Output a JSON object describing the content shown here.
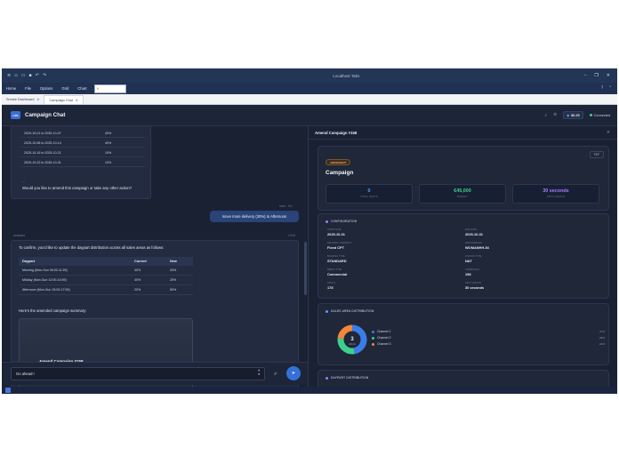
{
  "window": {
    "title": "Localhost Tabs",
    "controls": {
      "minimize": "–",
      "restore": "❐",
      "close": "✕"
    }
  },
  "ribbon": {
    "items": [
      "Home",
      "File",
      "Options",
      "Grid",
      "Chart"
    ],
    "search_value": "V"
  },
  "doc_tabs": [
    {
      "label": "Smoke Dashboard",
      "active": false
    },
    {
      "label": "Campaign Chat",
      "active": true
    }
  ],
  "header": {
    "logo_text": "LMS",
    "title": "Campaign Chat",
    "cost": "$0.25",
    "status": "Connected",
    "colors": {
      "accent": "#3470d8",
      "status_ok": "#3ecf8e"
    }
  },
  "chat": {
    "week_rows": [
      {
        "range": "2025-10-01 to 2025-10-07",
        "share": "40%"
      },
      {
        "range": "2025-10-08 to 2025-10-14",
        "share": "40%"
      },
      {
        "range": "2025-10-15 to 2025-10-21",
        "share": "10%"
      },
      {
        "range": "2025-10-22 to 2025-10-31",
        "share": "10%"
      }
    ],
    "ellipsis": "...",
    "question": "Would you like to amend this campaign or take any other action?",
    "user_meta": "none · 9m",
    "user_message": "move more delivery (30%) to Afternoon",
    "assistant_name": "Assistant",
    "assistant_meta": "13:06",
    "confirm_text": "To confirm, you'd like to update the daypart distribution across all sales areas as follows:",
    "daypart_table": {
      "headers": [
        "Daypart",
        "Current",
        "New"
      ],
      "rows": [
        [
          "Morning (Mon-Sun 06:00-11:59)",
          "40%",
          "25%"
        ],
        [
          "Midday (Mon-Sun 12:00-14:59)",
          "40%",
          "25%"
        ],
        [
          "Afternoon (Mon-Sun 15:00-17:59)",
          "20%",
          "50%"
        ]
      ]
    },
    "summary_label": "Here's the amended campaign summary:",
    "preview_title": "Amend Campaign #158",
    "input_value": "Go ahead !"
  },
  "panel": {
    "title": "Amend Campaign #158",
    "pdf_label": "PDF",
    "badge": "AMENDMENT",
    "campaign_name": "Campaign",
    "stats": [
      {
        "value": "0",
        "label": "TOTAL SPOTS"
      },
      {
        "value": "€45,000",
        "label": "BUDGET"
      },
      {
        "value": "30 seconds",
        "label": "SPOT LENGTH"
      }
    ],
    "config_title": "CONFIGURATION",
    "config": [
      {
        "key": "START DATE",
        "value": "2025-10-01"
      },
      {
        "key": "END DATE",
        "value": "2025-10-31"
      },
      {
        "key": "DELIVERY CURRENCY",
        "value": "Fixed CPT"
      },
      {
        "key": "DEMOGRAPHIC",
        "value": "WOMANHH-54"
      },
      {
        "key": "BOOKING TYPE",
        "value": "STANDARD"
      },
      {
        "key": "STATION TYPE",
        "value": "NAT"
      },
      {
        "key": "BREAK TYPE",
        "value": "Commercial"
      },
      {
        "key": "CAMPAIGN #",
        "value": "158"
      },
      {
        "key": "SPOT #",
        "value": "178"
      },
      {
        "key": "SPOT LENGTH",
        "value": "30 seconds"
      }
    ],
    "sales_title": "SALES AREA DISTRIBUTION",
    "donut_center": "3",
    "donut_label": "AREAS",
    "areas": [
      {
        "name": "Channel 1",
        "pct": "47%",
        "share": 47,
        "color": "#3b7de8"
      },
      {
        "name": "Channel 2",
        "pct": "29%",
        "share": 29,
        "color": "#3ecf8e"
      },
      {
        "name": "Channel 3",
        "pct": "24%",
        "share": 24,
        "color": "#f0873a"
      }
    ],
    "daypart_title": "DAYPART DISTRIBUTION"
  }
}
